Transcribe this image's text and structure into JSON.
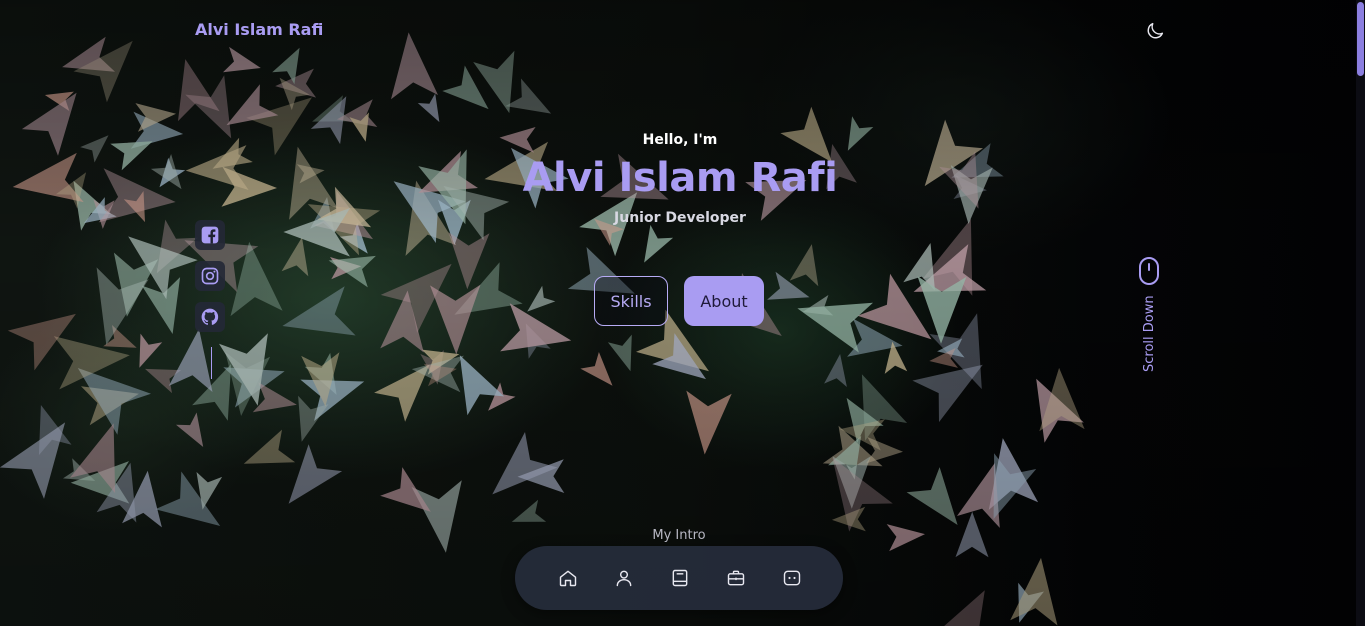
{
  "header": {
    "logo": "Alvi Islam Rafi",
    "theme_toggle_icon": "moon-icon"
  },
  "social": {
    "links": [
      {
        "icon": "facebook-icon"
      },
      {
        "icon": "instagram-icon"
      },
      {
        "icon": "github-icon"
      }
    ]
  },
  "hero": {
    "greeting": "Hello, I'm",
    "name": "Alvi Islam Rafi",
    "role": "Junior Developer",
    "buttons": {
      "skills_label": "Skills",
      "about_label": "About"
    }
  },
  "scroll": {
    "label": "Scroll Down",
    "icon": "mouse-icon"
  },
  "bottom_nav": {
    "section_label": "My Intro",
    "items": [
      {
        "icon": "home-icon"
      },
      {
        "icon": "user-icon"
      },
      {
        "icon": "book-icon"
      },
      {
        "icon": "briefcase-icon"
      },
      {
        "icon": "chat-icon"
      }
    ]
  },
  "colors": {
    "accent": "#a99cf2",
    "nav_bg": "#262c3c",
    "page_bg": "#05060a"
  }
}
